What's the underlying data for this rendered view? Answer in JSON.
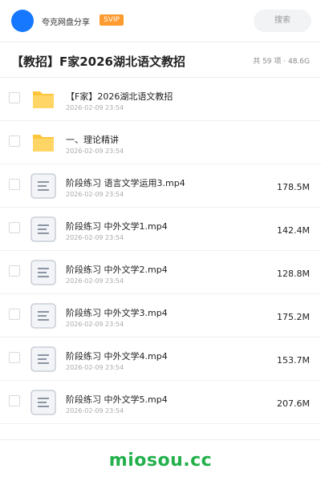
{
  "header": {
    "brand": "夸克网盘分享",
    "badge": "SVIP",
    "search_placeholder": "搜索",
    "accent_color": "#1677ff"
  },
  "folder": {
    "title": "【教招】F家2026湖北语文教招",
    "summary": "共 59 项 · 48.6G"
  },
  "files": [
    {
      "type": "folder",
      "icon": "folder-icon",
      "name": "【F家】2026湖北语文教招",
      "date": "2026-02-09 23:54",
      "size": ""
    },
    {
      "type": "folder",
      "icon": "folder-icon",
      "name": "一、理论精讲",
      "date": "2026-02-09 23:54",
      "size": ""
    },
    {
      "type": "video",
      "icon": "file-icon",
      "name": "阶段练习 语言文学运用3.mp4",
      "date": "2026-02-09 23:54",
      "size": "178.5M"
    },
    {
      "type": "video",
      "icon": "file-icon",
      "name": "阶段练习 中外文学1.mp4",
      "date": "2026-02-09 23:54",
      "size": "142.4M"
    },
    {
      "type": "video",
      "icon": "file-icon",
      "name": "阶段练习 中外文学2.mp4",
      "date": "2026-02-09 23:54",
      "size": "128.8M"
    },
    {
      "type": "video",
      "icon": "file-icon",
      "name": "阶段练习 中外文学3.mp4",
      "date": "2026-02-09 23:54",
      "size": "175.2M"
    },
    {
      "type": "video",
      "icon": "file-icon",
      "name": "阶段练习 中外文学4.mp4",
      "date": "2026-02-09 23:54",
      "size": "153.7M"
    },
    {
      "type": "video",
      "icon": "file-icon",
      "name": "阶段练习 中外文学5.mp4",
      "date": "2026-02-09 23:54",
      "size": "207.6M"
    }
  ],
  "watermark": "miosou.cc",
  "colors": {
    "folder": "#ffc53d",
    "watermark": "#22b04b",
    "badge": "#ff9a2e"
  }
}
